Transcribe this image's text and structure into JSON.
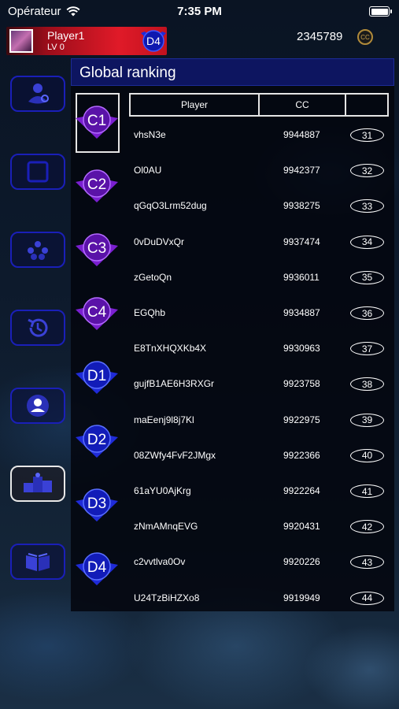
{
  "status_bar": {
    "carrier": "Opérateur",
    "time": "7:35 PM"
  },
  "player": {
    "name": "Player1",
    "level": "LV 0",
    "badge": "D4",
    "currency": "2345789",
    "coin_label": "CC"
  },
  "sidebar": {
    "items": [
      {
        "icon": "mask-icon"
      },
      {
        "icon": "square-icon"
      },
      {
        "icon": "group-icon"
      },
      {
        "icon": "history-icon"
      },
      {
        "icon": "profile-icon"
      },
      {
        "icon": "ranking-icon",
        "active": true
      },
      {
        "icon": "book-icon"
      }
    ]
  },
  "ranking": {
    "title": "Global ranking",
    "columns": {
      "player": "Player",
      "cc": "CC",
      "rank": ""
    },
    "leagues": [
      "C1",
      "C2",
      "C3",
      "C4",
      "D1",
      "D2",
      "D3",
      "D4"
    ],
    "rows": [
      {
        "name": "vhsN3e",
        "cc": "9944887",
        "rank": "31"
      },
      {
        "name": "Ol0AU",
        "cc": "9942377",
        "rank": "32"
      },
      {
        "name": "qGqO3Lrm52dug",
        "cc": "9938275",
        "rank": "33"
      },
      {
        "name": "0vDuDVxQr",
        "cc": "9937474",
        "rank": "34"
      },
      {
        "name": "zGetoQn",
        "cc": "9936011",
        "rank": "35"
      },
      {
        "name": "EGQhb",
        "cc": "9934887",
        "rank": "36"
      },
      {
        "name": "E8TnXHQXKb4X",
        "cc": "9930963",
        "rank": "37"
      },
      {
        "name": "gujfB1AE6H3RXGr",
        "cc": "9923758",
        "rank": "38"
      },
      {
        "name": "maEenj9l8j7Kl",
        "cc": "9922975",
        "rank": "39"
      },
      {
        "name": "08ZWfy4FvF2JMgx",
        "cc": "9922366",
        "rank": "40"
      },
      {
        "name": "61aYU0AjKrg",
        "cc": "9922264",
        "rank": "41"
      },
      {
        "name": "zNmAMnqEVG",
        "cc": "9920431",
        "rank": "42"
      },
      {
        "name": "c2vvtlva0Ov",
        "cc": "9920226",
        "rank": "43"
      },
      {
        "name": "U24TzBiHZXo8",
        "cc": "9919949",
        "rank": "44"
      }
    ]
  },
  "colors": {
    "accent_blue": "#1a1fb8",
    "header_blue": "#0d1560",
    "player_red": "#e01a28",
    "league_c": "#7a1fd0",
    "league_d": "#1f2bd8"
  }
}
